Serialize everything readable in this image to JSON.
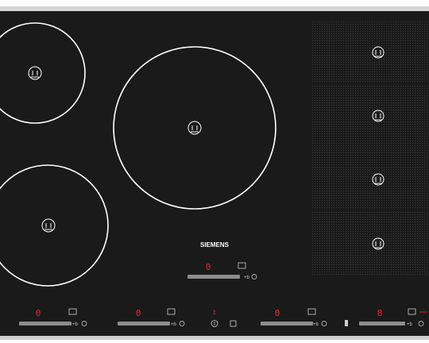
{
  "brand": {
    "name": "SIEMENS"
  },
  "colors": {
    "frame": "#b9b9b9",
    "glass": "#1a1a1a",
    "ring": "#ffffff",
    "display_red": "#e0262c",
    "slider": "#8c8c8c"
  },
  "burner_icons": [
    "induction-zone-icon",
    "induction-zone-icon",
    "induction-zone-icon",
    "induction-zone-icon",
    "induction-zone-icon",
    "induction-zone-icon",
    "induction-zone-icon"
  ],
  "controls": {
    "top_display": "0",
    "bottom_displays": [
      "0",
      "0",
      "0",
      "8"
    ],
    "center_indicator": "I"
  }
}
